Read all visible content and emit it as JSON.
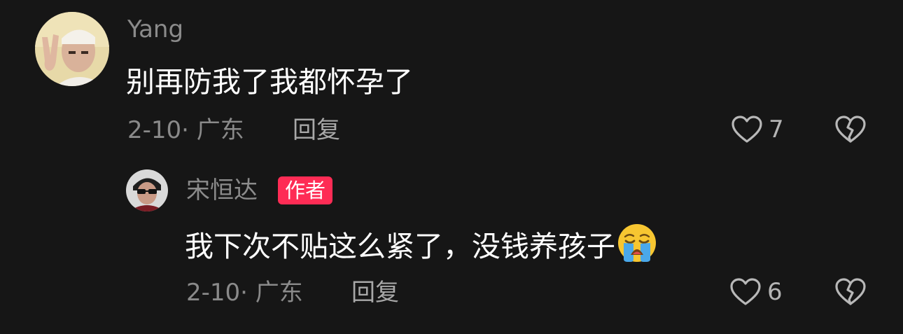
{
  "comments": [
    {
      "username": "Yang",
      "text": "别再防我了我都怀孕了",
      "date_location": "2-10· 广东",
      "reply_label": "回复",
      "likes": "7",
      "like_icon": "heart-outline-icon",
      "dislike_icon": "broken-heart-icon"
    }
  ],
  "replies": [
    {
      "username": "宋恒达",
      "badge": "作者",
      "text": "我下次不贴这么紧了，没钱养孩子",
      "emoji": "loudly-crying-face",
      "date_location": "2-10· 广东",
      "reply_label": "回复",
      "likes": "6",
      "like_icon": "heart-outline-icon",
      "dislike_icon": "broken-heart-icon"
    }
  ],
  "colors": {
    "background": "#161616",
    "username": "#8b8b8b",
    "badge": "#fe2c55",
    "text": "#ffffff",
    "meta": "#8a8a8a"
  }
}
